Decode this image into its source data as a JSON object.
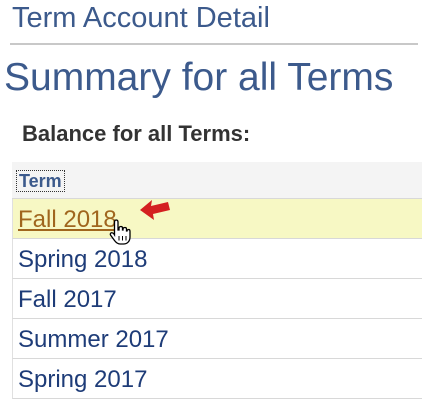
{
  "header": {
    "title": "Term Account Detail"
  },
  "summary": {
    "title": "Summary for all Terms",
    "balance_label": "Balance for all Terms:"
  },
  "table": {
    "column_header": "Term",
    "rows": [
      {
        "label": "Fall 2018",
        "selected": true
      },
      {
        "label": "Spring 2018",
        "selected": false
      },
      {
        "label": "Fall 2017",
        "selected": false
      },
      {
        "label": "Summer 2017",
        "selected": false
      },
      {
        "label": "Spring 2017",
        "selected": false
      }
    ]
  },
  "icons": {
    "annotation_arrow": "red-arrow-icon",
    "cursor": "hand-pointer-icon"
  },
  "colors": {
    "heading": "#3c5a8c",
    "link": "#1e3c78",
    "selected_link": "#a0661e",
    "selected_row_bg": "#f7f8c4",
    "arrow": "#d42020"
  }
}
